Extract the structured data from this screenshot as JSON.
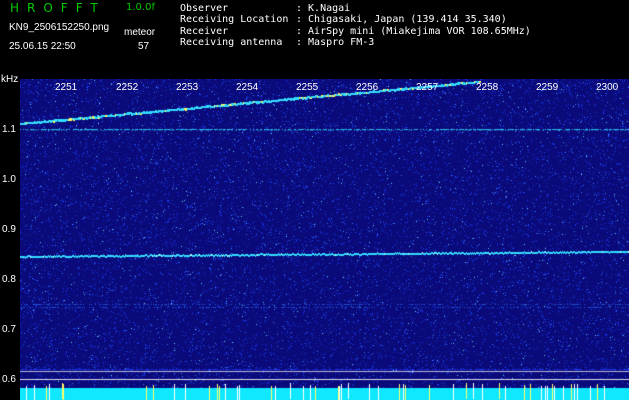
{
  "header": {
    "logo": "HROFFT",
    "version": "1.0.0f",
    "filename": "KN9_2506152250.png",
    "mode": "meteor",
    "datetime": "25.06.15 22:50",
    "count": "57",
    "info": [
      {
        "key": "Observer",
        "value": ": K.Nagai"
      },
      {
        "key": "Receiving Location",
        "value": ": Chigasaki, Japan (139.414 35.340)"
      },
      {
        "key": "Receiver",
        "value": ": AirSpy mini (Miakejima VOR 108.65MHz)"
      },
      {
        "key": "Receiving antenna",
        "value": ": Maspro FM-3"
      }
    ]
  },
  "spectrogram": {
    "y_unit": "kHz",
    "y_ticks": [
      "1.1",
      "1.0",
      "0.9",
      "0.8",
      "0.7",
      "0.6"
    ],
    "x_ticks": [
      "2251",
      "2252",
      "2253",
      "2254",
      "2255",
      "2256",
      "2257",
      "2258",
      "2259",
      "2300"
    ],
    "colors": {
      "background": "#0a0a7a",
      "noise": "#1c3cff",
      "signal": "#33ddff",
      "bright": "#ffff66",
      "bottom_band": "#10e8ff"
    }
  }
}
